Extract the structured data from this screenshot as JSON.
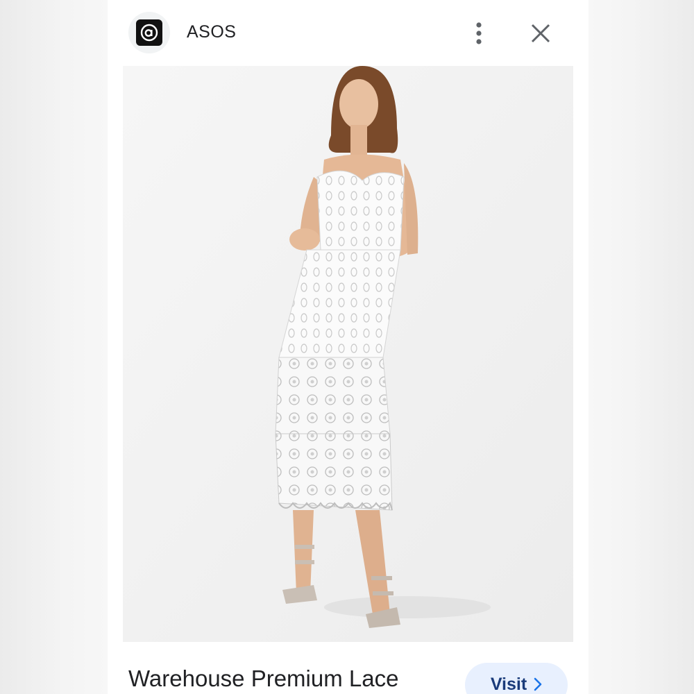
{
  "header": {
    "source_name": "ASOS",
    "favicon_letter": "a",
    "more_icon": "more-vert-icon",
    "close_icon": "close-icon"
  },
  "image": {
    "subject": "product-photo"
  },
  "footer": {
    "product_title": "Warehouse Premium Lace",
    "visit_label": "Visit"
  },
  "colors": {
    "visit_bg": "#e8f0fe",
    "visit_text": "#1a3b7a",
    "text": "#202124",
    "icon": "#5f6368"
  }
}
